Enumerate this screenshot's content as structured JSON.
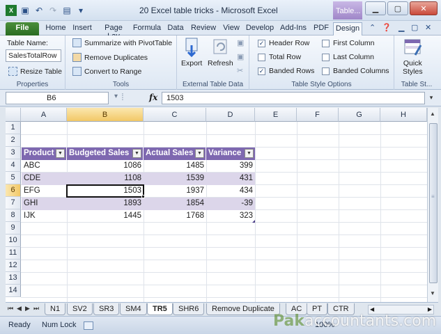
{
  "window": {
    "title": "20 Excel table tricks  -  Microsoft Excel",
    "context_tab": "Table...",
    "minimize": "▁",
    "maximize": "▢",
    "close": "✕"
  },
  "ribbon_tabs": [
    "File",
    "Home",
    "Insert",
    "Page Lay",
    "Formula",
    "Data",
    "Review",
    "View",
    "Develop",
    "Add-Ins",
    "PDF",
    "Design"
  ],
  "ribbon": {
    "properties": {
      "table_name_label": "Table Name:",
      "table_name_value": "SalesTotalRow",
      "resize_label": "Resize Table",
      "group_label": "Properties"
    },
    "tools": {
      "summarize": "Summarize with PivotTable",
      "remove_duplicates": "Remove Duplicates",
      "convert_to_range": "Convert to Range",
      "group_label": "Tools"
    },
    "external": {
      "export": "Export",
      "refresh": "Refresh",
      "group_label": "External Table Data"
    },
    "style_options": {
      "header_row": "Header Row",
      "total_row": "Total Row",
      "banded_rows": "Banded Rows",
      "first_column": "First Column",
      "last_column": "Last Column",
      "banded_columns": "Banded Columns",
      "group_label": "Table Style Options",
      "checked": {
        "header_row": true,
        "total_row": false,
        "banded_rows": true,
        "first_column": false,
        "last_column": false,
        "banded_columns": false
      }
    },
    "styles": {
      "quick_styles_1": "Quick",
      "quick_styles_2": "Styles",
      "group_label": "Table St..."
    }
  },
  "formula_bar": {
    "name_box": "B6",
    "fx": "fx",
    "value": "1503"
  },
  "columns": [
    "A",
    "B",
    "C",
    "D",
    "E",
    "F",
    "G",
    "H"
  ],
  "rows": [
    "1",
    "2",
    "3",
    "4",
    "5",
    "6",
    "7",
    "8",
    "9",
    "10",
    "11",
    "12",
    "13",
    "14"
  ],
  "table": {
    "headers": [
      "Product",
      "Budgeted Sales",
      "Actual Sales",
      "Variance"
    ],
    "rows": [
      [
        "ABC",
        "1086",
        "1485",
        "399"
      ],
      [
        "CDE",
        "1108",
        "1539",
        "431"
      ],
      [
        "EFG",
        "1503",
        "1937",
        "434"
      ],
      [
        "GHI",
        "1893",
        "1854",
        "-39"
      ],
      [
        "IJK",
        "1445",
        "1768",
        "323"
      ]
    ]
  },
  "sheet_tabs": [
    "N1",
    "SV2",
    "SR3",
    "SM4",
    "TR5",
    "SHR6",
    "Remove Duplicate",
    "AC",
    "PT",
    "CTR"
  ],
  "active_sheet": "TR5",
  "status": {
    "ready": "Ready",
    "num_lock": "Num Lock",
    "zoom": "100%"
  },
  "watermark": {
    "brand": "Pak",
    "rest": "accountants.com"
  },
  "colors": {
    "table_header": "#7e68b0",
    "band": "#dcd6ea",
    "file_tab": "#2a6d22",
    "selection": "#f2c866"
  }
}
